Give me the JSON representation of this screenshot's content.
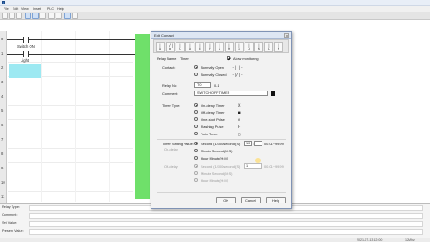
{
  "menu": {
    "items": [
      "File",
      "Edit",
      "View",
      "Insert",
      "PLC",
      "Help"
    ]
  },
  "ladder": {
    "row_numbers": [
      "0",
      "1",
      "2",
      "3",
      "4",
      "5",
      "6",
      "7",
      "8",
      "9",
      "10",
      "11"
    ],
    "contact_labels": [
      "Switch ON",
      "Light"
    ]
  },
  "info_panel": {
    "labels": [
      "Relay Type:",
      "Comment:",
      "Set Value:",
      "Present Value:"
    ]
  },
  "status_bar": {
    "left": "",
    "right": [
      "2021-07-13 12:00",
      "12Mhz"
    ]
  },
  "dialog": {
    "title": "Edit Contact",
    "close": "x",
    "tools": [
      {
        "glyph": "|",
        "sub": "A"
      },
      {
        "glyph": "|/|",
        "sub": "B"
      },
      {
        "glyph": "|",
        "sub": "C"
      },
      {
        "glyph": "|",
        "sub": "D"
      },
      {
        "glyph": "|",
        "sub": "E"
      },
      {
        "glyph": "|",
        "sub": "F"
      },
      {
        "glyph": "|",
        "sub": "G"
      },
      {
        "glyph": "|",
        "sub": "H"
      },
      {
        "glyph": "|",
        "sub": "I"
      },
      {
        "glyph": "|",
        "sub": "J"
      },
      {
        "glyph": "|",
        "sub": "K"
      },
      {
        "glyph": "|",
        "sub": "L"
      },
      {
        "glyph": "|",
        "sub": "M"
      }
    ],
    "relay_name_label": "Relay Name:",
    "relay_name_value": "Timer",
    "allow_monitoring": "Allow monitoring",
    "contact_label": "Contact:",
    "normally_open": "Normally Open",
    "normally_open_sym": "-| |-",
    "normally_closed": "Normally Closed",
    "normally_closed_sym": "-|/|-",
    "relay_no_label": "Relay No:",
    "relay_no_value": "T0",
    "relay_no_range": "0-1",
    "comment_label": "Comment:",
    "comment_value": "SWITCH OFF TIMER",
    "timer_type_label": "Timer Type:",
    "timer_types": [
      {
        "label": "On-delay Timer",
        "sym": "X",
        "selected": true
      },
      {
        "label": "Off-delay Timer",
        "sym": "■",
        "selected": false
      },
      {
        "label": "One-shot Pulse",
        "sym": "∩",
        "selected": false
      },
      {
        "label": "Flashing Pulse",
        "sym": "F",
        "selected": false
      },
      {
        "label": "Twin Timer",
        "sym": "□",
        "selected": false
      }
    ],
    "timer_setting_label": "Timer Setting Value:",
    "on_delay_sub": "On-delay",
    "off_delay_sub": "Off-delay",
    "setting_units": [
      {
        "label": "Second (1/100second)(S)",
        "selected": true
      },
      {
        "label": "Minute Second(M:S)",
        "selected": false
      },
      {
        "label": "Hour Minute(H:M)",
        "selected": false
      }
    ],
    "setting_value": "10",
    "setting_sep": ":",
    "setting_value2": "",
    "setting_range": "00.01~99.99",
    "off_setting_units": [
      {
        "label": "Second (1/100second)(S)",
        "selected": true
      },
      {
        "label": "Minute Second(M:S)",
        "selected": false
      },
      {
        "label": "Hour Minute(H:M)",
        "selected": false
      }
    ],
    "off_setting_value": "1",
    "off_setting_range": "00.01~99.99",
    "ok": "OK",
    "cancel": "Cancel",
    "help": "Help"
  },
  "colors": {
    "green_bar": "#6fe06a",
    "cyan_cell": "#9de9f2"
  }
}
